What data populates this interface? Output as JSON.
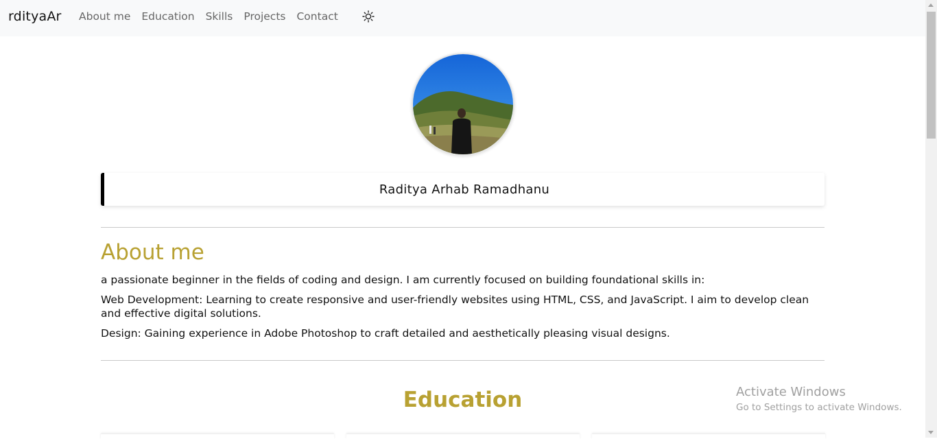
{
  "navbar": {
    "brand": "rdityaAr",
    "links": [
      {
        "label": "About me"
      },
      {
        "label": "Education"
      },
      {
        "label": "Skills"
      },
      {
        "label": "Projects"
      },
      {
        "label": "Contact"
      }
    ],
    "theme_icon": "sun-icon"
  },
  "profile": {
    "name": "Raditya Arhab Ramadhanu"
  },
  "about": {
    "title": "About me",
    "paragraphs": [
      "a passionate beginner in the fields of coding and design. I am currently focused on building foundational skills in:",
      "Web Development: Learning to create responsive and user-friendly websites using HTML, CSS, and JavaScript. I aim to develop clean and effective digital solutions.",
      "Design: Gaining experience in Adobe Photoshop to craft detailed and aesthetically pleasing visual designs."
    ]
  },
  "education": {
    "title": "Education"
  },
  "watermark": {
    "title": "Activate Windows",
    "subtitle": "Go to Settings to activate Windows."
  },
  "colors": {
    "accent": "#b8a132",
    "navbar_bg": "#f8f9fa",
    "nav_link": "#666666",
    "card_border": "#000000"
  }
}
